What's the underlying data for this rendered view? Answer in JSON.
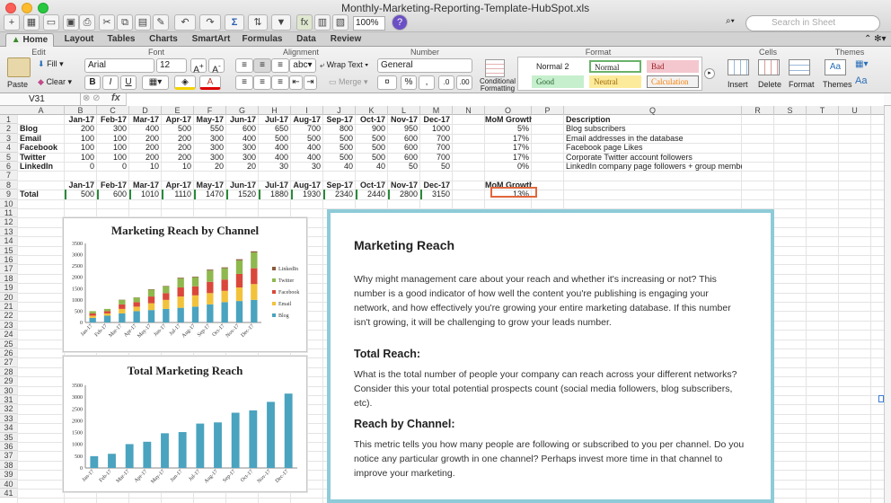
{
  "window": {
    "title": "Monthly-Marketing-Reporting-Template-HubSpot.xls",
    "zoom": "100%",
    "search_placeholder": "Search in Sheet"
  },
  "tabs": [
    "Home",
    "Layout",
    "Tables",
    "Charts",
    "SmartArt",
    "Formulas",
    "Data",
    "Review"
  ],
  "ribbon": {
    "groups": [
      "Edit",
      "Font",
      "Alignment",
      "Number",
      "Format",
      "Cells",
      "Themes"
    ],
    "paste": "Paste",
    "fill": "Fill",
    "clear": "Clear",
    "font_name": "Arial",
    "font_size": "12",
    "wrap_text": "Wrap Text",
    "merge": "Merge",
    "number_format": "General",
    "conditional_formatting": "Conditional Formatting",
    "styles": [
      {
        "label": "Normal 2",
        "bg": "#ffffff",
        "color": "#000000"
      },
      {
        "label": "Normal",
        "bg": "#ffffff",
        "color": "#000000"
      },
      {
        "label": "Bad",
        "bg": "#f4c7ce",
        "color": "#9c1c24"
      },
      {
        "label": "Good",
        "bg": "#c6efcd",
        "color": "#22612b"
      },
      {
        "label": "Neutral",
        "bg": "#fdeb9c",
        "color": "#9c6500"
      },
      {
        "label": "Calculation",
        "bg": "#f2f2f2",
        "color": "#fa7d00"
      }
    ],
    "insert": "Insert",
    "delete": "Delete",
    "format": "Format",
    "themes": "Themes",
    "aa": "Aa"
  },
  "formula_bar": {
    "name_box": "V31",
    "fx": "fx",
    "value": ""
  },
  "columns": [
    "A",
    "B",
    "C",
    "D",
    "E",
    "F",
    "G",
    "H",
    "I",
    "J",
    "K",
    "L",
    "M",
    "N",
    "O",
    "P",
    "Q",
    "R",
    "S",
    "T",
    "U"
  ],
  "row_count": 41,
  "sheet": {
    "months": [
      "Jan-17",
      "Feb-17",
      "Mar-17",
      "Apr-17",
      "May-17",
      "Jun-17",
      "Jul-17",
      "Aug-17",
      "Sep-17",
      "Oct-17",
      "Nov-17",
      "Dec-17"
    ],
    "mom_header": "MoM Growth",
    "desc_header": "Description",
    "rows": [
      {
        "name": "Blog",
        "values": [
          "200",
          "300",
          "400",
          "500",
          "550",
          "600",
          "650",
          "700",
          "800",
          "900",
          "950",
          "1000"
        ],
        "mom": "5%",
        "desc": "Blog subscribers"
      },
      {
        "name": "Email",
        "values": [
          "100",
          "100",
          "200",
          "200",
          "300",
          "400",
          "500",
          "500",
          "500",
          "500",
          "600",
          "700"
        ],
        "mom": "17%",
        "desc": "Email addresses in the database"
      },
      {
        "name": "Facebook",
        "values": [
          "100",
          "100",
          "200",
          "200",
          "300",
          "300",
          "400",
          "400",
          "500",
          "500",
          "600",
          "700"
        ],
        "mom": "17%",
        "desc": "Facebook page Likes"
      },
      {
        "name": "Twitter",
        "values": [
          "100",
          "100",
          "200",
          "200",
          "300",
          "300",
          "400",
          "400",
          "500",
          "500",
          "600",
          "700"
        ],
        "mom": "17%",
        "desc": "Corporate Twitter account followers"
      },
      {
        "name": "LinkedIn",
        "values": [
          "0",
          "0",
          "10",
          "10",
          "20",
          "20",
          "30",
          "30",
          "40",
          "40",
          "50",
          "50"
        ],
        "mom": "0%",
        "desc": "LinkedIn company page followers + group members"
      }
    ],
    "total": {
      "name": "Total",
      "values": [
        "500",
        "600",
        "1010",
        "1110",
        "1470",
        "1520",
        "1880",
        "1930",
        "2340",
        "2440",
        "2800",
        "3150"
      ],
      "mom": "13%"
    }
  },
  "chart_data": [
    {
      "type": "bar",
      "stacked": true,
      "title": "Marketing Reach by Channel",
      "categories": [
        "Jan-17",
        "Feb-17",
        "Mar-17",
        "Apr-17",
        "May-17",
        "Jun-17",
        "Jul-17",
        "Aug-17",
        "Sep-17",
        "Oct-17",
        "Nov-17",
        "Dec-17"
      ],
      "ylim": [
        0,
        3500
      ],
      "yticks": [
        "0",
        "500",
        "1000",
        "1500",
        "2000",
        "2500",
        "3000",
        "3500"
      ],
      "legend_position": "right",
      "grid": false,
      "series": [
        {
          "name": "Blog",
          "color": "#4aa3bf",
          "values": [
            200,
            300,
            400,
            500,
            550,
            600,
            650,
            700,
            800,
            900,
            950,
            1000
          ]
        },
        {
          "name": "Email",
          "color": "#f3c23c",
          "values": [
            100,
            100,
            200,
            200,
            300,
            400,
            500,
            500,
            500,
            500,
            600,
            700
          ]
        },
        {
          "name": "Facebook",
          "color": "#d9483b",
          "values": [
            100,
            100,
            200,
            200,
            300,
            300,
            400,
            400,
            500,
            500,
            600,
            700
          ]
        },
        {
          "name": "Twitter",
          "color": "#8fb84e",
          "values": [
            100,
            100,
            200,
            200,
            300,
            300,
            400,
            400,
            500,
            500,
            600,
            700
          ]
        },
        {
          "name": "LinkedIn",
          "color": "#8a5a3c",
          "values": [
            0,
            0,
            10,
            10,
            20,
            20,
            30,
            30,
            40,
            40,
            50,
            50
          ]
        }
      ]
    },
    {
      "type": "bar",
      "title": "Total Marketing Reach",
      "categories": [
        "Jan-17",
        "Feb-17",
        "Mar-17",
        "Apr-17",
        "May-17",
        "Jun-17",
        "Jul-17",
        "Aug-17",
        "Sep-17",
        "Oct-17",
        "Nov-17",
        "Dec-17"
      ],
      "ylim": [
        0,
        3500
      ],
      "yticks": [
        "0",
        "500",
        "1000",
        "1500",
        "2000",
        "2500",
        "3000",
        "3500"
      ],
      "grid": false,
      "series": [
        {
          "color": "#4aa3bf",
          "values": [
            500,
            600,
            1010,
            1110,
            1470,
            1520,
            1880,
            1930,
            2340,
            2440,
            2800,
            3150
          ]
        }
      ]
    }
  ],
  "panel": {
    "title": "Marketing Reach",
    "intro": "Why might management care about your reach and whether it's increasing or not? This number is a good indicator of how well the content you're publishing is engaging your network, and how effectively you're growing your entire marketing database. If this number isn't growing, it will be challenging to grow your leads number.",
    "h2": "Total Reach:",
    "p2": "What is the total number of people your company can reach across your different networks? Consider this your total potential prospects count (social media followers, blog subscribers, etc).",
    "h3": "Reach by Channel:",
    "p3": "This metric tells you how many people are following or subscribed to you per channel. Do you notice any particular growth in one channel? Perhaps invest more time in that channel to improve your marketing."
  }
}
